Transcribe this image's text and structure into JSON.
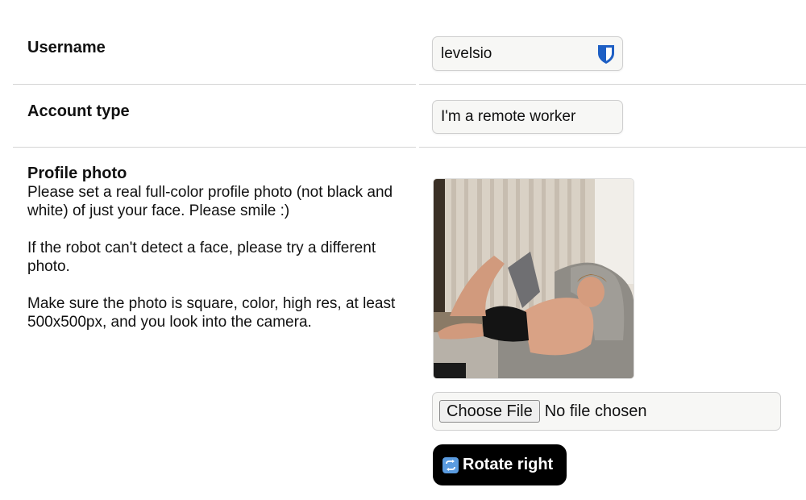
{
  "username": {
    "label": "Username",
    "value": "levelsio",
    "icon": "shield-icon"
  },
  "account_type": {
    "label": "Account type",
    "value": "I'm a remote worker"
  },
  "profile_photo": {
    "label": "Profile photo",
    "paragraphs": [
      "Please set a real full-color profile photo (not black and white) of just your face. Please smile :)",
      "If the robot can't detect a face, please try a different photo.",
      "Make sure the photo is square, color, high res, at least 500x500px, and you look into the camera."
    ],
    "file_button": "Choose File",
    "file_status": "No file chosen",
    "rotate_button": "Rotate right",
    "rotate_icon": "rotate-icon"
  },
  "colors": {
    "button_bg": "#000000",
    "accent_shield": "#1e5fc4"
  }
}
